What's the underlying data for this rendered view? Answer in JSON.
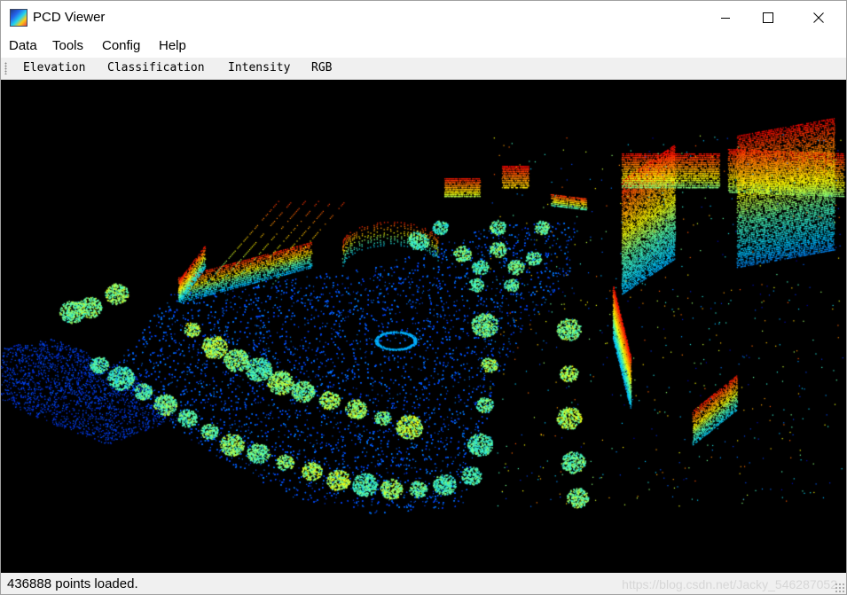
{
  "window": {
    "title": "PCD Viewer",
    "app_icon": "point-cloud-app-icon",
    "controls": [
      "minimize-icon",
      "maximize-icon",
      "close-icon"
    ]
  },
  "menu": {
    "items": [
      {
        "label": "Data"
      },
      {
        "label": "Tools"
      },
      {
        "label": "Config"
      },
      {
        "label": "Help"
      }
    ]
  },
  "toolbar": {
    "buttons": [
      {
        "label": "Elevation"
      },
      {
        "label": "Classification"
      },
      {
        "label": "Intensity"
      },
      {
        "label": "RGB"
      }
    ]
  },
  "viewport": {
    "background": "#000000",
    "color_mode": "Elevation",
    "colormap": [
      "#0000b4",
      "#0050ff",
      "#00c8ff",
      "#50ffb4",
      "#ffff00",
      "#ff8000",
      "#ff0000"
    ]
  },
  "status": {
    "message": "436888 points loaded.",
    "watermark": "https://blog.csdn.net/Jacky_546287052"
  }
}
